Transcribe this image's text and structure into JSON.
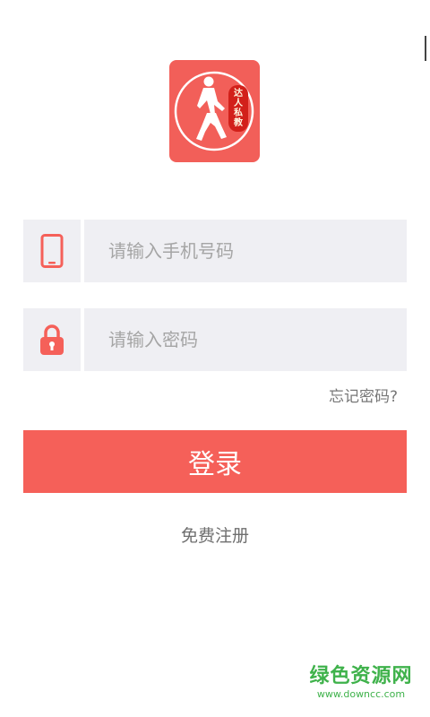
{
  "logo": {
    "seal_chars": [
      "达",
      "人",
      "私",
      "教"
    ]
  },
  "phone_field": {
    "placeholder": "请输入手机号码",
    "value": ""
  },
  "password_field": {
    "placeholder": "请输入密码",
    "value": ""
  },
  "forgot_password_label": "忘记密码?",
  "login_button_label": "登录",
  "register_link_label": "免费注册",
  "watermark": {
    "title": "绿色资源网",
    "url": "www.downcc.com"
  },
  "icons": {
    "phone": "phone-icon",
    "lock": "lock-icon"
  },
  "colors": {
    "accent": "#f56059",
    "field_background": "#efeff3",
    "seal": "#d2201a",
    "watermark": "#3fb24b"
  }
}
